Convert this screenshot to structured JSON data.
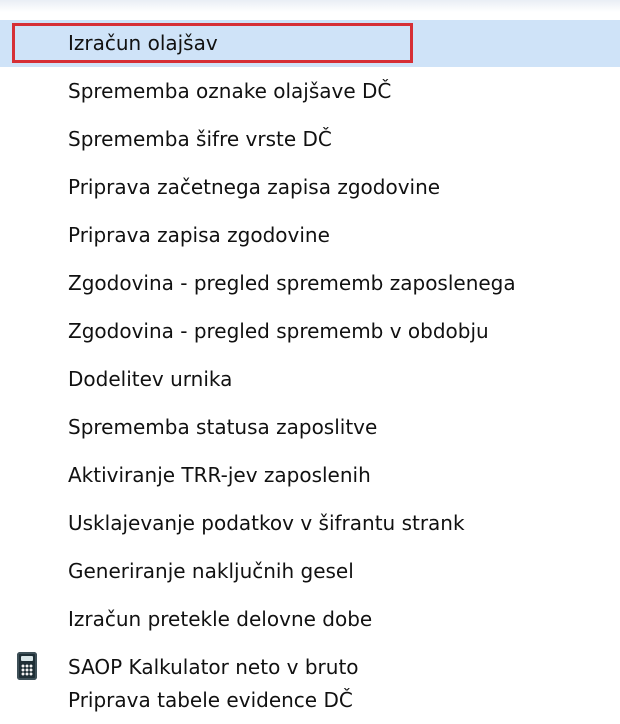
{
  "menu": {
    "items": [
      {
        "label": "Izračun olajšav",
        "highlighted": true,
        "icon": ""
      },
      {
        "label": "Sprememba oznake olajšave DČ",
        "highlighted": false,
        "icon": ""
      },
      {
        "label": "Sprememba šifre vrste DČ",
        "highlighted": false,
        "icon": ""
      },
      {
        "label": "Priprava začetnega zapisa zgodovine",
        "highlighted": false,
        "icon": ""
      },
      {
        "label": "Priprava zapisa zgodovine",
        "highlighted": false,
        "icon": ""
      },
      {
        "label": "Zgodovina - pregled sprememb zaposlenega",
        "highlighted": false,
        "icon": ""
      },
      {
        "label": "Zgodovina - pregled sprememb v obdobju",
        "highlighted": false,
        "icon": ""
      },
      {
        "label": "Dodelitev urnika",
        "highlighted": false,
        "icon": ""
      },
      {
        "label": "Sprememba statusa zaposlitve",
        "highlighted": false,
        "icon": ""
      },
      {
        "label": "Aktiviranje TRR-jev zaposlenih",
        "highlighted": false,
        "icon": ""
      },
      {
        "label": "Usklajevanje podatkov v šifrantu strank",
        "highlighted": false,
        "icon": ""
      },
      {
        "label": "Generiranje naključnih gesel",
        "highlighted": false,
        "icon": ""
      },
      {
        "label": "Izračun pretekle delovne dobe",
        "highlighted": false,
        "icon": ""
      },
      {
        "label": "SAOP Kalkulator neto v bruto",
        "highlighted": false,
        "icon": "calculator-icon"
      },
      {
        "label": "Priprava tabele evidence DČ",
        "highlighted": false,
        "icon": ""
      }
    ]
  },
  "colors": {
    "highlight": "#cfe3f8",
    "selection_border": "#d62f36",
    "text": "#111111"
  }
}
